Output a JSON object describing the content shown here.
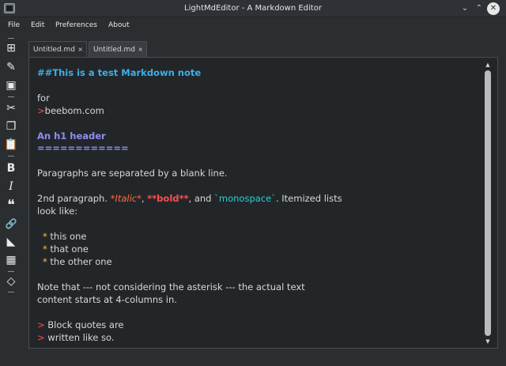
{
  "window": {
    "title": "LightMdEditor - A Markdown Editor",
    "controls": {
      "minimize": "⌄",
      "maximize": "⌃",
      "close": "✕"
    }
  },
  "menu": {
    "items": [
      {
        "label": "File"
      },
      {
        "label": "Edit"
      },
      {
        "label": "Preferences"
      },
      {
        "label": "About"
      }
    ]
  },
  "toolbar": {
    "tools": [
      {
        "name": "new-file-icon",
        "glyph": "⊞"
      },
      {
        "name": "edit-file-icon",
        "glyph": "✎"
      },
      {
        "name": "save-icon",
        "glyph": "▣"
      },
      {
        "name": "cut-icon",
        "glyph": "✂"
      },
      {
        "name": "copy-icon",
        "glyph": "❐"
      },
      {
        "name": "paste-icon",
        "glyph": "📋"
      },
      {
        "name": "bold-icon",
        "glyph": "B"
      },
      {
        "name": "italic-icon",
        "glyph": "I"
      },
      {
        "name": "quote-icon",
        "glyph": "❝"
      },
      {
        "name": "link-icon",
        "glyph": "🔗"
      },
      {
        "name": "image-icon",
        "glyph": "◣"
      },
      {
        "name": "table-icon",
        "glyph": "▦"
      },
      {
        "name": "code-icon",
        "glyph": "◇"
      }
    ]
  },
  "tabs": [
    {
      "label": "Untitled.md",
      "close": "×",
      "active": false
    },
    {
      "label": "Untitled.md",
      "close": "×",
      "active": true
    }
  ],
  "editor": {
    "lines": {
      "heading": "##This is a test Markdown note",
      "for": "for",
      "gt1": ">",
      "site": "beebom.com",
      "h1": "An h1 header",
      "h1_underline": "============",
      "para1": "Paragraphs are separated by a blank line.",
      "para2_a": "2nd paragraph. ",
      "italic": "*Italic*",
      "comma1": ", ",
      "bold": "**bold**",
      "and": ", and ",
      "mono": "`monospace`",
      "para2_b": ". Itemized lists",
      "para2_c": "look like:",
      "star": "*",
      "item1": " this one",
      "item2": " that one",
      "item3": " the other one",
      "note1": "Note that --- not considering the asterisk --- the actual text",
      "note2": "content starts at 4-columns in.",
      "gt2": ">",
      "quote1": " Block quotes are",
      "gt3": ">",
      "quote2": " written like so."
    }
  },
  "colors": {
    "heading": "#3daee9",
    "h1": "#8e8ef0",
    "marker": "#f0534d",
    "italic": "#ff6c3c",
    "bold": "#ff5050",
    "monospace": "#2ad0d0",
    "list_star": "#f0c040"
  }
}
